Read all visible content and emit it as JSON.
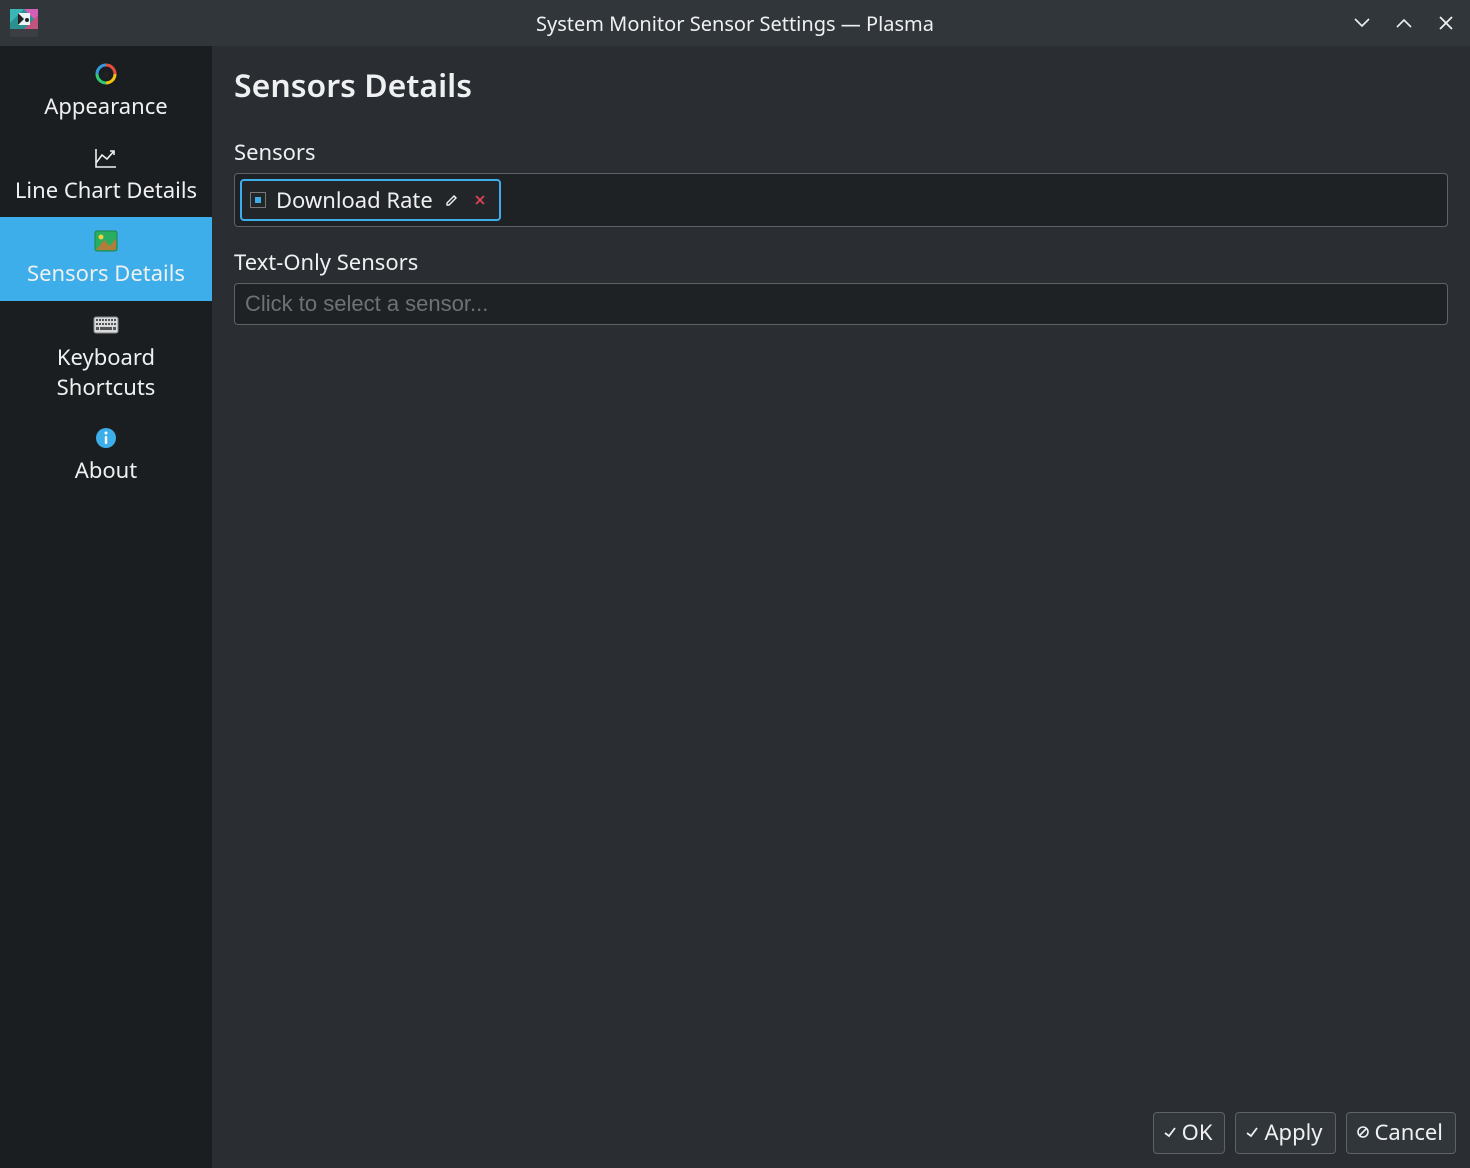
{
  "window": {
    "title": "System Monitor Sensor Settings — Plasma"
  },
  "sidebar": {
    "items": [
      {
        "id": "appearance",
        "label": "Appearance",
        "icon": "appearance-icon",
        "active": false
      },
      {
        "id": "line-chart",
        "label": "Line Chart Details",
        "icon": "line-chart-icon",
        "active": false
      },
      {
        "id": "sensors-details",
        "label": "Sensors Details",
        "icon": "image-icon",
        "active": true
      },
      {
        "id": "keyboard-shortcuts",
        "label": "Keyboard Shortcuts",
        "icon": "keyboard-icon",
        "active": false
      },
      {
        "id": "about",
        "label": "About",
        "icon": "info-icon",
        "active": false
      }
    ]
  },
  "page": {
    "title": "Sensors Details",
    "sensors_label": "Sensors",
    "text_only_label": "Text-Only Sensors",
    "text_only_placeholder": "Click to select a sensor...",
    "selected_sensor": {
      "label": "Download Rate",
      "color": "#3daee9"
    }
  },
  "buttons": {
    "ok": "OK",
    "apply": "Apply",
    "cancel": "Cancel"
  }
}
